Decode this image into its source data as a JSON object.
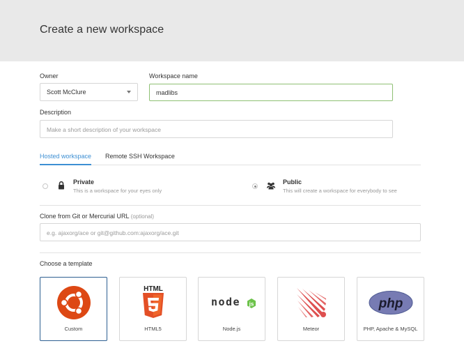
{
  "header": {
    "title": "Create a new workspace"
  },
  "owner": {
    "label": "Owner",
    "value": "Scott McClure"
  },
  "workspace_name": {
    "label": "Workspace name",
    "value": "madlibs"
  },
  "description": {
    "label": "Description",
    "placeholder": "Make a short description of your workspace"
  },
  "tabs": [
    {
      "label": "Hosted workspace",
      "active": true
    },
    {
      "label": "Remote SSH Workspace",
      "active": false
    }
  ],
  "visibility": {
    "private": {
      "title": "Private",
      "desc": "This is a workspace for your eyes only",
      "icon": "lock-icon",
      "checked": false
    },
    "public": {
      "title": "Public",
      "desc": "This will create a workspace for everybody to see",
      "icon": "users-icon",
      "checked": true
    }
  },
  "clone": {
    "label": "Clone from Git or Mercurial URL",
    "optional": "(optional)",
    "placeholder": "e.g. ajaxorg/ace or git@github.com:ajaxorg/ace.git"
  },
  "templates": {
    "label": "Choose a template",
    "items": [
      {
        "label": "Custom",
        "icon": "ubuntu-logo",
        "selected": true
      },
      {
        "label": "HTML5",
        "icon": "html5-logo",
        "logo_text": "HTML",
        "selected": false
      },
      {
        "label": "Node.js",
        "icon": "nodejs-logo",
        "logo_text": "node",
        "selected": false
      },
      {
        "label": "Meteor",
        "icon": "meteor-logo",
        "selected": false
      },
      {
        "label": "PHP, Apache & MySQL",
        "icon": "php-logo",
        "logo_text": "php",
        "selected": false
      }
    ]
  },
  "colors": {
    "accent": "#3d8fd3",
    "active_border": "#8ec073",
    "ubuntu": "#dd4814",
    "html5": "#e34f26",
    "nodejs": "#333333",
    "node_green": "#6cc24a",
    "meteor": "#de4f4f",
    "php": "#777bb3"
  }
}
